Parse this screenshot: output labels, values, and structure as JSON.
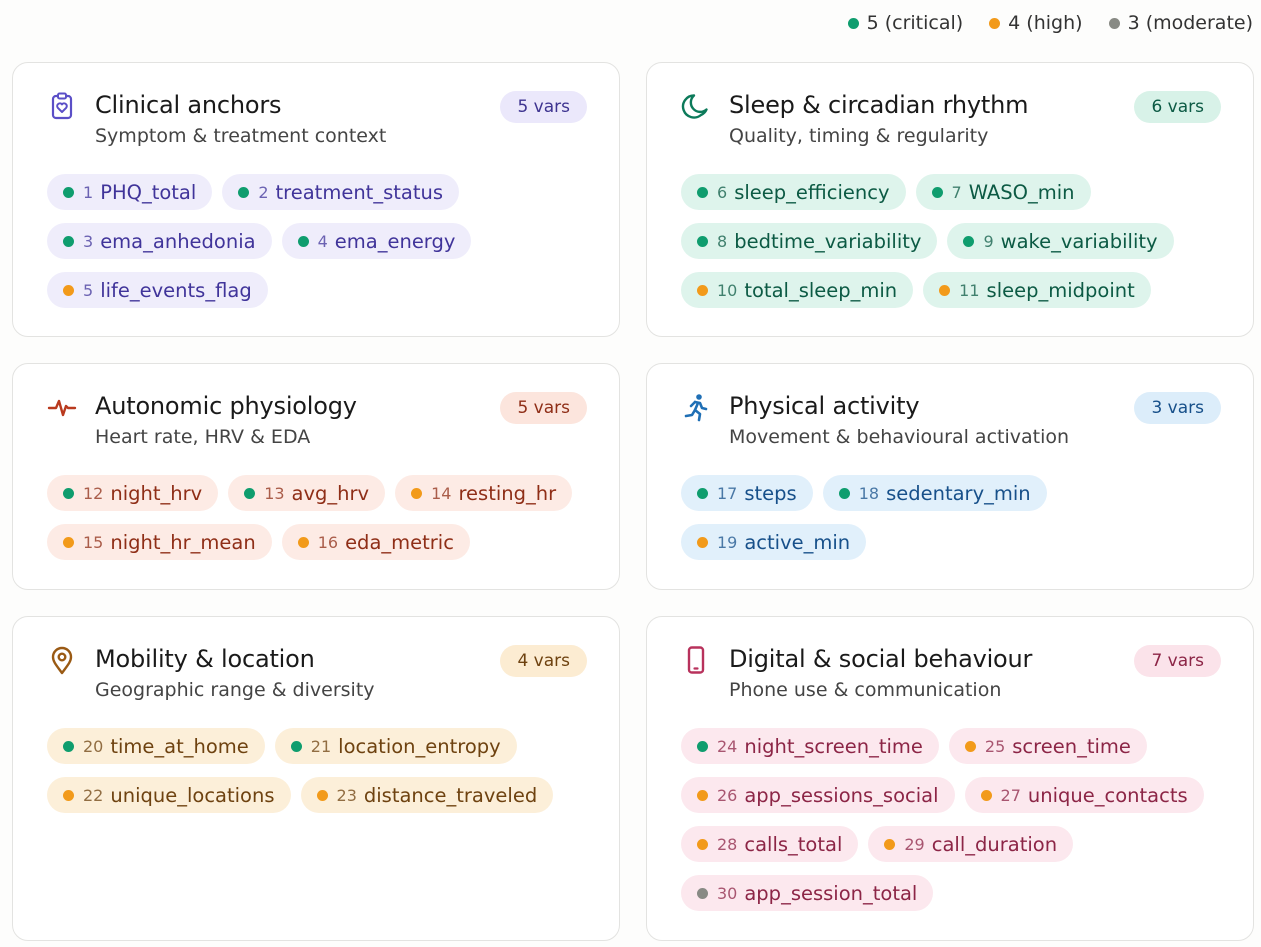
{
  "legend": [
    {
      "label": "5 (critical)",
      "color": "#0f9d6e"
    },
    {
      "label": "4 (high)",
      "color": "#f29a1a"
    },
    {
      "label": "3 (moderate)",
      "color": "#888a84"
    }
  ],
  "levels": {
    "5": "#0f9d6e",
    "4": "#f29a1a",
    "3": "#888a84"
  },
  "cards": [
    {
      "id": "clinical",
      "icon": "clipboard-heart-icon",
      "title": "Clinical anchors",
      "subtitle": "Symptom & treatment context",
      "badge": "5 vars",
      "colors": {
        "accent": "#5b4fc7",
        "chip_bg": "#efedfb",
        "chip_text": "#40349a",
        "badge_bg": "#ebe8fb",
        "badge_text": "#3e3490"
      },
      "vars": [
        {
          "num": "1",
          "name": "PHQ_total",
          "level": 5
        },
        {
          "num": "2",
          "name": "treatment_status",
          "level": 5
        },
        {
          "num": "3",
          "name": "ema_anhedonia",
          "level": 5
        },
        {
          "num": "4",
          "name": "ema_energy",
          "level": 5
        },
        {
          "num": "5",
          "name": "life_events_flag",
          "level": 4
        }
      ]
    },
    {
      "id": "sleep",
      "icon": "moon-icon",
      "title": "Sleep & circadian rhythm",
      "subtitle": "Quality, timing & regularity",
      "badge": "6 vars",
      "colors": {
        "accent": "#0c7a5a",
        "chip_bg": "#def4ec",
        "chip_text": "#0c5a44",
        "badge_bg": "#d8f2e8",
        "badge_text": "#0c5a44"
      },
      "vars": [
        {
          "num": "6",
          "name": "sleep_efficiency",
          "level": 5
        },
        {
          "num": "7",
          "name": "WASO_min",
          "level": 5
        },
        {
          "num": "8",
          "name": "bedtime_variability",
          "level": 5
        },
        {
          "num": "9",
          "name": "wake_variability",
          "level": 5
        },
        {
          "num": "10",
          "name": "total_sleep_min",
          "level": 4
        },
        {
          "num": "11",
          "name": "sleep_midpoint",
          "level": 4
        }
      ]
    },
    {
      "id": "autonomic",
      "icon": "heartbeat-icon",
      "title": "Autonomic physiology",
      "subtitle": "Heart rate, HRV & EDA",
      "badge": "5 vars",
      "colors": {
        "accent": "#b93a1e",
        "chip_bg": "#fdebe5",
        "chip_text": "#8f2e17",
        "badge_bg": "#fce5dd",
        "badge_text": "#8f2e17"
      },
      "vars": [
        {
          "num": "12",
          "name": "night_hrv",
          "level": 5
        },
        {
          "num": "13",
          "name": "avg_hrv",
          "level": 5
        },
        {
          "num": "14",
          "name": "resting_hr",
          "level": 4
        },
        {
          "num": "15",
          "name": "night_hr_mean",
          "level": 4
        },
        {
          "num": "16",
          "name": "eda_metric",
          "level": 4
        }
      ]
    },
    {
      "id": "activity",
      "icon": "running-person-icon",
      "title": "Physical activity",
      "subtitle": "Movement & behavioural activation",
      "badge": "3 vars",
      "colors": {
        "accent": "#1f6fb5",
        "chip_bg": "#e1f0fb",
        "chip_text": "#17508a",
        "badge_bg": "#dcedfa",
        "badge_text": "#17508a"
      },
      "vars": [
        {
          "num": "17",
          "name": "steps",
          "level": 5
        },
        {
          "num": "18",
          "name": "sedentary_min",
          "level": 5
        },
        {
          "num": "19",
          "name": "active_min",
          "level": 4
        }
      ]
    },
    {
      "id": "mobility",
      "icon": "location-pin-icon",
      "title": "Mobility & location",
      "subtitle": "Geographic range & diversity",
      "badge": "4 vars",
      "colors": {
        "accent": "#9a5a14",
        "chip_bg": "#fcefd9",
        "chip_text": "#6e4210",
        "badge_bg": "#fcecd2",
        "badge_text": "#6e4210"
      },
      "vars": [
        {
          "num": "20",
          "name": "time_at_home",
          "level": 5
        },
        {
          "num": "21",
          "name": "location_entropy",
          "level": 5
        },
        {
          "num": "22",
          "name": "unique_locations",
          "level": 4
        },
        {
          "num": "23",
          "name": "distance_traveled",
          "level": 4
        }
      ]
    },
    {
      "id": "digital",
      "icon": "smartphone-icon",
      "title": "Digital & social behaviour",
      "subtitle": "Phone use & communication",
      "badge": "7 vars",
      "colors": {
        "accent": "#b8325c",
        "chip_bg": "#fce8ee",
        "chip_text": "#8c2546",
        "badge_bg": "#fbe3ea",
        "badge_text": "#8c2546"
      },
      "vars": [
        {
          "num": "24",
          "name": "night_screen_time",
          "level": 5
        },
        {
          "num": "25",
          "name": "screen_time",
          "level": 4
        },
        {
          "num": "26",
          "name": "app_sessions_social",
          "level": 4
        },
        {
          "num": "27",
          "name": "unique_contacts",
          "level": 4
        },
        {
          "num": "28",
          "name": "calls_total",
          "level": 4
        },
        {
          "num": "29",
          "name": "call_duration",
          "level": 4
        },
        {
          "num": "30",
          "name": "app_session_total",
          "level": 3
        }
      ]
    }
  ]
}
